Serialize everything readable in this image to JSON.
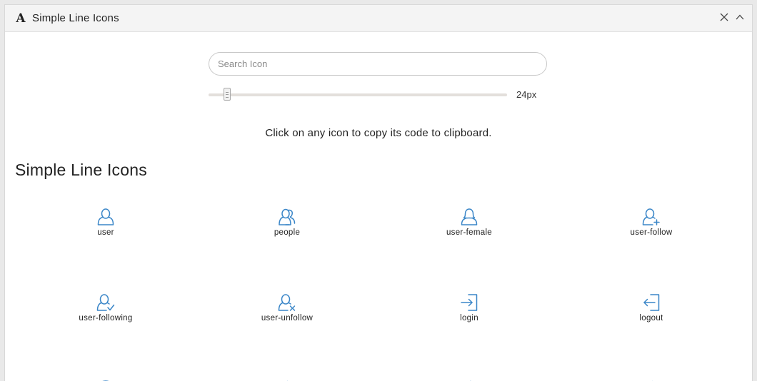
{
  "window": {
    "logo": "A",
    "title": "Simple Line Icons"
  },
  "search": {
    "placeholder": "Search Icon",
    "value": ""
  },
  "size_slider": {
    "value_label": "24px",
    "level_fraction": 0.05
  },
  "hint": "Click on any icon to copy its code to clipboard.",
  "section": {
    "title": "Simple Line Icons",
    "icons": [
      {
        "name": "user-icon",
        "label": "user"
      },
      {
        "name": "people-icon",
        "label": "people"
      },
      {
        "name": "user-female-icon",
        "label": "user-female"
      },
      {
        "name": "user-follow-icon",
        "label": "user-follow"
      },
      {
        "name": "user-following-icon",
        "label": "user-following"
      },
      {
        "name": "user-unfollow-icon",
        "label": "user-unfollow"
      },
      {
        "name": "login-icon",
        "label": "login"
      },
      {
        "name": "logout-icon",
        "label": "logout"
      }
    ]
  },
  "colors": {
    "icon": "#3a86c8",
    "text": "#222222"
  }
}
